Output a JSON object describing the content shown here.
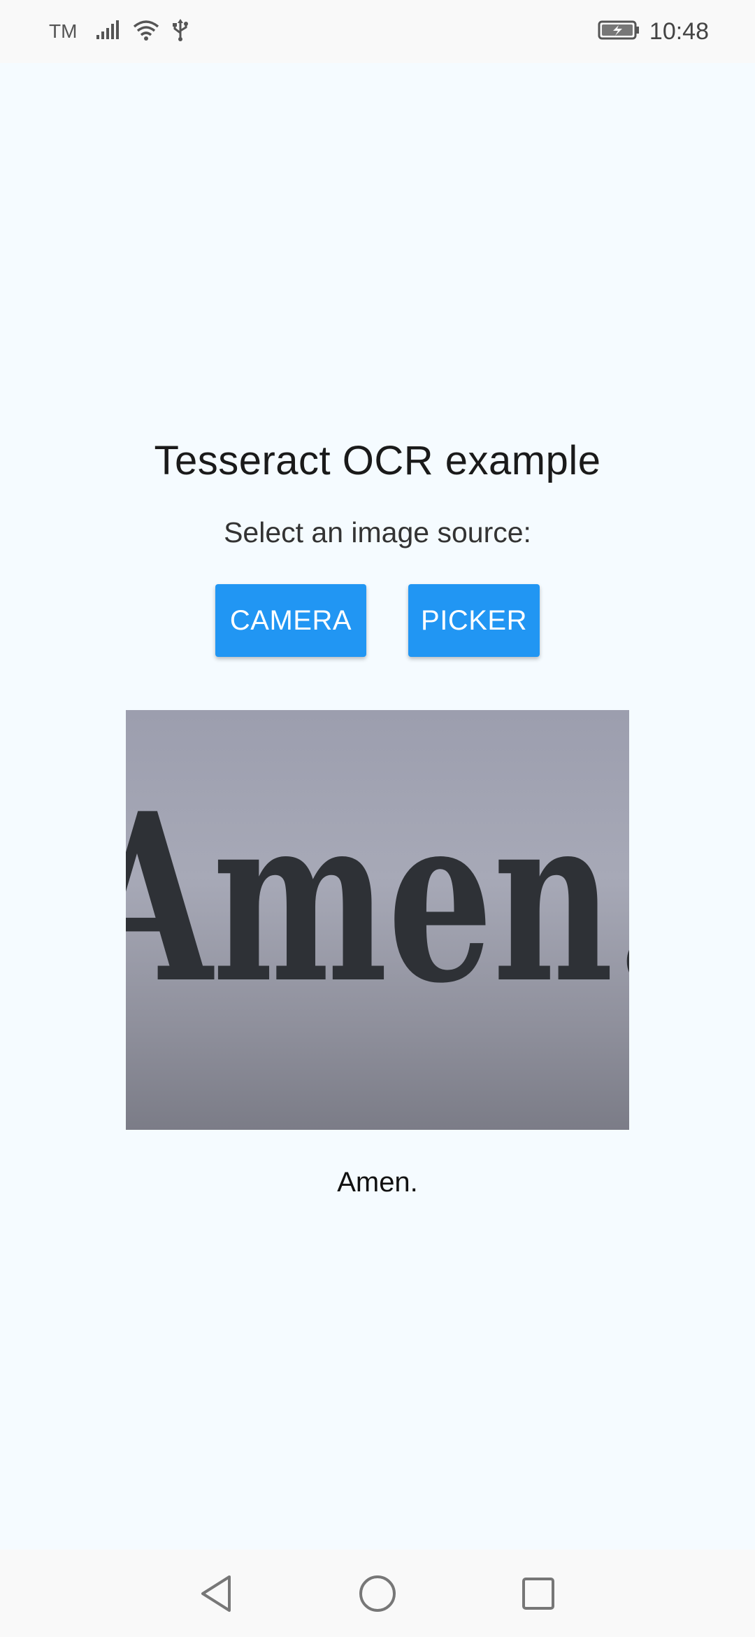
{
  "status_bar": {
    "carrier": "TM",
    "time": "10:48",
    "icons": [
      "signal-icon",
      "wifi-icon",
      "usb-icon",
      "battery-charging-icon"
    ]
  },
  "app": {
    "title": "Tesseract OCR example",
    "subtitle": "Select an image source:",
    "buttons": {
      "camera_label": "CAMERA",
      "picker_label": "PICKER"
    },
    "preview": {
      "image_text": "Amen."
    },
    "result_text": "Amen."
  },
  "nav_bar": {
    "icons": [
      "back-icon",
      "home-icon",
      "recents-icon"
    ]
  },
  "colors": {
    "accent": "#2196f3",
    "background": "#f5fbff",
    "system_bar": "#f9f9f9"
  }
}
